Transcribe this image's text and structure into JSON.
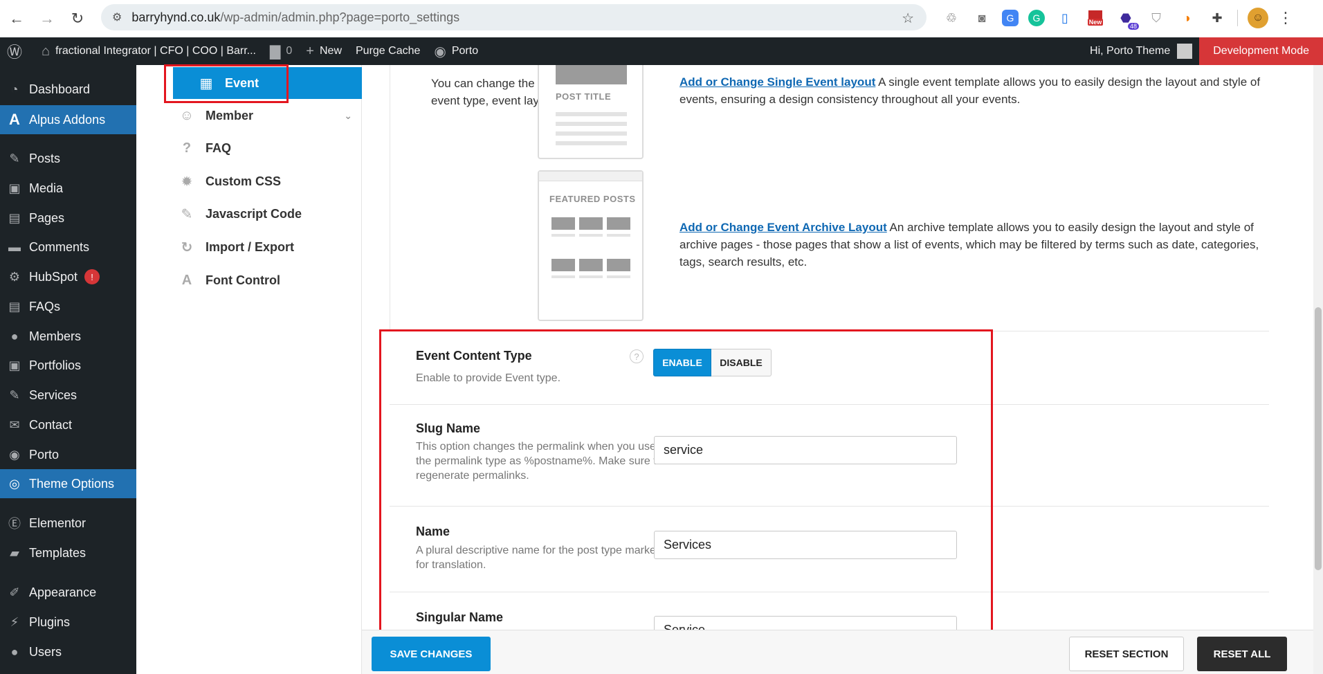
{
  "browser": {
    "url_host": "barryhynd.co.uk",
    "url_path": "/wp-admin/admin.php?page=porto_settings",
    "extensions": [
      "recycle-icon",
      "camera-icon",
      "translate-icon",
      "grammarly-icon",
      "clipboard-icon",
      "new-badge-icon",
      "notification-48-icon",
      "shield-icon",
      "colorful-icon",
      "puzzle-icon"
    ],
    "ext_new_label": "New",
    "ext_count_label": "48"
  },
  "adminbar": {
    "site_name": "fractional Integrator | CFO | COO | Barr...",
    "comments_count": "0",
    "new_label": "New",
    "purge_label": "Purge Cache",
    "porto_label": "Porto",
    "howdy": "Hi, Porto Theme",
    "dev_mode": "Development Mode"
  },
  "wpmenu": {
    "items": [
      {
        "label": "Dashboard",
        "icon": "dashboard-icon"
      },
      {
        "label": "Alpus Addons",
        "icon": "alpus-icon"
      },
      {
        "label": "Posts",
        "icon": "pin-icon"
      },
      {
        "label": "Media",
        "icon": "media-icon"
      },
      {
        "label": "Pages",
        "icon": "pages-icon"
      },
      {
        "label": "Comments",
        "icon": "comments-icon"
      },
      {
        "label": "HubSpot",
        "icon": "hubspot-icon",
        "badge": "!"
      },
      {
        "label": "FAQs",
        "icon": "faq-icon"
      },
      {
        "label": "Members",
        "icon": "members-icon"
      },
      {
        "label": "Portfolios",
        "icon": "portfolio-icon"
      },
      {
        "label": "Services",
        "icon": "pin-icon"
      },
      {
        "label": "Contact",
        "icon": "mail-icon"
      },
      {
        "label": "Porto",
        "icon": "porto-icon"
      },
      {
        "label": "Theme Options",
        "icon": "theme-options-icon"
      },
      {
        "label": "Elementor",
        "icon": "elementor-icon"
      },
      {
        "label": "Templates",
        "icon": "folder-icon"
      },
      {
        "label": "Appearance",
        "icon": "brush-icon"
      },
      {
        "label": "Plugins",
        "icon": "plugin-icon"
      },
      {
        "label": "Users",
        "icon": "user-icon"
      }
    ]
  },
  "optnav": {
    "items": [
      {
        "label": "Event",
        "icon": "calendar-icon"
      },
      {
        "label": "Member",
        "icon": "member-icon"
      },
      {
        "label": "FAQ",
        "icon": "question-icon"
      },
      {
        "label": "Custom CSS",
        "icon": "gear-icon"
      },
      {
        "label": "Javascript Code",
        "icon": "edit-icon"
      },
      {
        "label": "Import / Export",
        "icon": "refresh-icon"
      },
      {
        "label": "Font Control",
        "icon": "font-icon"
      }
    ]
  },
  "content": {
    "intro_desc": "You can change the event type, event layout.",
    "thumb_single_caption": "POST TITLE",
    "thumb_archive_caption": "FEATURED POSTS",
    "single_link": "Add or Change Single Event layout",
    "single_text": " A single event template allows you to easily design the layout and style of events, ensuring a design consistency throughout all your events.",
    "archive_link": "Add or Change Event Archive Layout",
    "archive_text": " An archive template allows you to easily design the layout and style of archive pages - those pages that show a list of events, which may be filtered by terms such as date, categories, tags, search results, etc."
  },
  "fields": {
    "content_type": {
      "title": "Event Content Type",
      "desc": "Enable to provide Event type.",
      "help": "?",
      "enable": "ENABLE",
      "disable": "DISABLE"
    },
    "slug": {
      "title": "Slug Name",
      "desc": "This option changes the permalink when you use the permalink type as %postname%. Make sure to regenerate permalinks.",
      "value": "service"
    },
    "name": {
      "title": "Name",
      "desc": "A plural descriptive name for the post type marked for translation.",
      "value": "Services"
    },
    "singular": {
      "title": "Singular Name",
      "value": "Service"
    }
  },
  "footer": {
    "save": "SAVE CHANGES",
    "reset_section": "RESET SECTION",
    "reset_all": "RESET ALL"
  },
  "colors": {
    "accent": "#0a8ed6",
    "wp_dark": "#1d2327",
    "highlight_red": "#e3161f",
    "dev_mode_red": "#d63638"
  }
}
